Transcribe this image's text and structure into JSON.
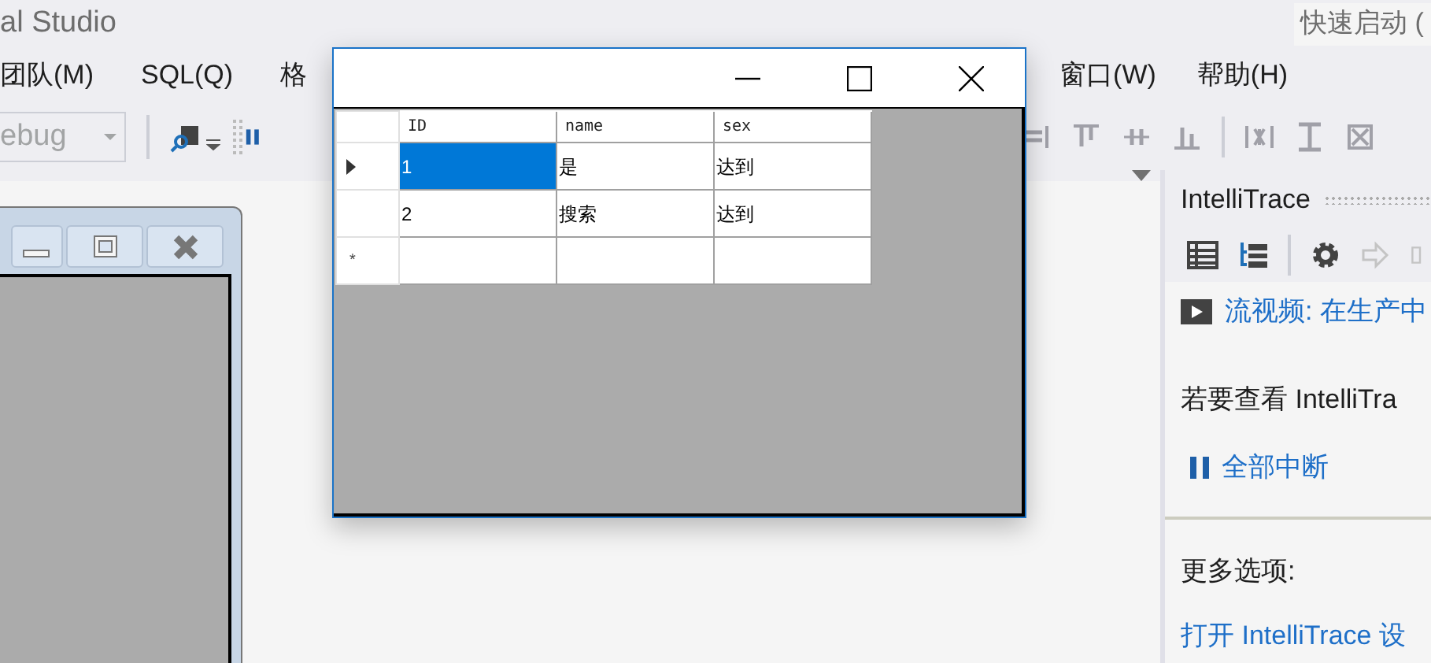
{
  "ide": {
    "title": "al Studio",
    "quick_launch": "快速启动 (",
    "menu_left": [
      "团队(M)",
      "SQL(Q)",
      "格"
    ],
    "menu_right": [
      "窗口(W)",
      "帮助(H)"
    ],
    "config_combo": {
      "value": "ebug",
      "disabled": true
    }
  },
  "intellitrace": {
    "title": "IntelliTrace",
    "video_link": "流视频: 在生产中",
    "info_text": "若要查看 IntelliTra",
    "break_all": "全部中断",
    "more_options": "更多选项:",
    "open_settings": "打开 IntelliTrace 设"
  },
  "form_window": {
    "columns": [
      "ID",
      "name",
      "sex"
    ],
    "rows": [
      {
        "current": true,
        "cells": [
          {
            "text": "1",
            "selected": true
          },
          {
            "text": "是",
            "selected": false
          },
          {
            "text": "达到",
            "selected": false
          }
        ]
      },
      {
        "current": false,
        "cells": [
          {
            "text": "2",
            "selected": false
          },
          {
            "text": "搜索",
            "selected": false
          },
          {
            "text": "达到",
            "selected": false
          }
        ]
      }
    ],
    "new_row_marker": "*"
  }
}
